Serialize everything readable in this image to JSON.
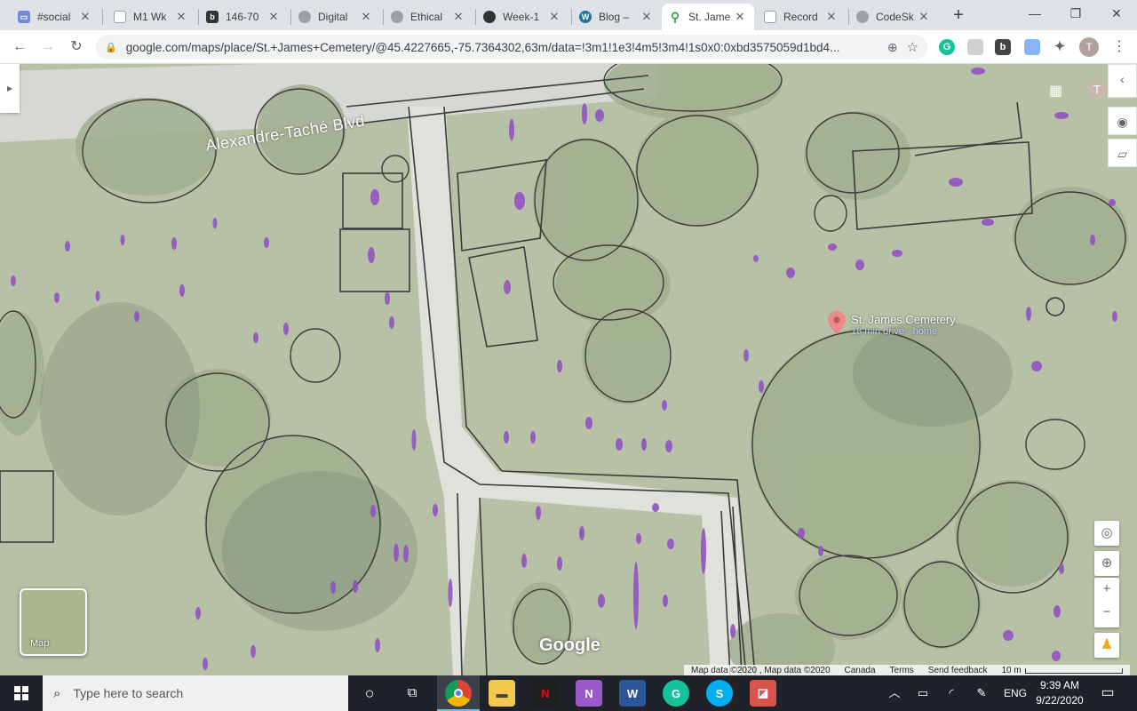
{
  "browser": {
    "tabs": [
      {
        "label": "#social",
        "icon": "discord-icon",
        "color": "#7289da"
      },
      {
        "label": "M1 Wk",
        "icon": "document-icon",
        "color": "#9aa0a6"
      },
      {
        "label": "146-70",
        "icon": "bitly-icon",
        "color": "#555555"
      },
      {
        "label": "Digital",
        "icon": "globe-icon",
        "color": "#9aa0a6"
      },
      {
        "label": "Ethical",
        "icon": "globe-icon",
        "color": "#9aa0a6"
      },
      {
        "label": "Week-1",
        "icon": "github-icon",
        "color": "#333333"
      },
      {
        "label": "Blog – ",
        "icon": "wordpress-icon",
        "color": "#21759b"
      },
      {
        "label": "St. Jame",
        "icon": "maps-pin-icon",
        "color": "#34a853"
      },
      {
        "label": "Record",
        "icon": "document-icon",
        "color": "#9aa0a6"
      },
      {
        "label": "CodeSk",
        "icon": "globe-icon",
        "color": "#9aa0a6"
      }
    ],
    "active_tab": 7,
    "new_tab": "+",
    "window_controls": {
      "minimize": "—",
      "restore": "❐",
      "close": "✕"
    },
    "url": "google.com/maps/place/St.+James+Cemetery/@45.4227665,-75.7364302,63m/data=!3m1!1e3!4m5!3m4!1s0x0:0xbd3575059d1bd4...",
    "profile_initial": "T"
  },
  "map": {
    "road_label": "Alexandre-Taché Blvd",
    "place_name": "St. James Cemetery",
    "place_sub": "18 min drive - home",
    "profile_initial": "T",
    "layer_label": "Map",
    "logo": "Google",
    "attribution": [
      "Map data ©2020 , Map data ©2020",
      "Canada",
      "Terms",
      "Send feedback"
    ],
    "scale_label": "10 m"
  },
  "taskbar": {
    "search_placeholder": "Type here to search",
    "language": "ENG",
    "time": "9:39 AM",
    "date": "9/22/2020"
  }
}
